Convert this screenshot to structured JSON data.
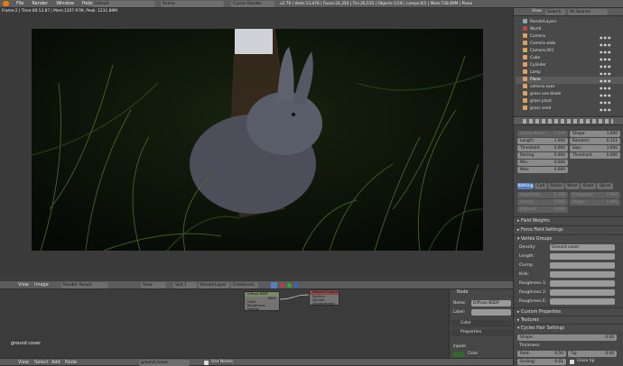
{
  "top": {
    "menus": [
      "File",
      "Render",
      "Window",
      "Help"
    ],
    "layout": "Default",
    "scene": "Scene",
    "engine": "Cycles Render",
    "stats": "v2.79 | Verts:13,476 | Faces:24,350 | Tris:26,535 | Objects:1/18 | Lamps:0/1 | Mem:738.89M | Plane"
  },
  "viewport": {
    "info": "Frame:2 | Time:06:13.87 | Mem:1207.97M, Peak: 1231.89M"
  },
  "image_editor": {
    "menus": [
      "View",
      "Image"
    ],
    "image": "Render Result",
    "view": "View",
    "slot": "Slot 1",
    "layer": "RenderLayer",
    "pass": "Combined"
  },
  "node_editor": {
    "label": "ground cover",
    "menus": [
      "View",
      "Select",
      "Add",
      "Node"
    ],
    "material": "ground cover",
    "use_nodes": "Use Nodes",
    "nodes": [
      {
        "title": "Diffuse BSDF",
        "rows": [
          "BSDF",
          "Color",
          "Roughness",
          "Normal"
        ]
      },
      {
        "title": "Material Output",
        "rows": [
          "Surface",
          "Volume",
          "Displacement"
        ]
      }
    ]
  },
  "node_props": {
    "node_header": "Node",
    "name_label": "Name:",
    "name_value": "Diffuse BSDF",
    "label_label": "Label:",
    "color": "Color",
    "properties": "Properties",
    "inputs": "Inputs:",
    "input_color": "Color"
  },
  "outliner": {
    "menus": [
      "View",
      "Search",
      "All Scenes"
    ],
    "items": [
      "RenderLayers",
      "World",
      "Camera",
      "Camera wide",
      "Camera.001",
      "Cube",
      "Cylinder",
      "Lamp",
      "Plane",
      "camera eyes",
      "grass one blade",
      "grass plant",
      "grass seed"
    ]
  },
  "particles": {
    "clump_noise": {
      "label": "Clump Noise:",
      "value": "1.000"
    },
    "shape": {
      "label": "Shape:",
      "value": "1.000"
    },
    "length": {
      "label": "Length:",
      "value": "1.000"
    },
    "random": {
      "label": "Random:",
      "value": "0.111"
    },
    "threshold": {
      "label": "Threshold:",
      "value": "0.000"
    },
    "size": {
      "label": "Size:",
      "value": "1.000"
    },
    "parting": {
      "label": "Parting:",
      "value": "0.000"
    },
    "threshold2": {
      "label": "Threshold:",
      "value": "0.000"
    },
    "min": {
      "label": "Min:",
      "value": "0.000"
    },
    "max": {
      "label": "Max:",
      "value": "0.000"
    },
    "kink_tabs": [
      "Nothing",
      "Curl",
      "Radial",
      "Wave",
      "Braid",
      "Spiral"
    ],
    "amplitude": {
      "label": "Amplitude:",
      "value": "0.200"
    },
    "frequency": {
      "label": "Frequency:",
      "value": "2.000"
    },
    "clump": {
      "label": "Clump:",
      "value": "0.000"
    },
    "shape2": {
      "label": "Shape:",
      "value": "0.000"
    },
    "flatness": {
      "label": "Flatness:",
      "value": "0.000"
    },
    "panels": [
      "Field Weights",
      "Force Field Settings",
      "Vertex Groups"
    ],
    "density_label": "Density:",
    "density_value": "Ground cover",
    "vg_rows": [
      "Length:",
      "Clump:",
      "Kink:",
      "Roughness 1:",
      "Roughness 2:",
      "Roughness E:"
    ],
    "panels2": [
      "Custom Properties",
      "Textures",
      "Cycles Hair Settings"
    ],
    "hair_shape": {
      "label": "Shape:",
      "value": "0.00"
    },
    "thickness": "Thickness:",
    "root": {
      "label": "Root:",
      "value": "0.50"
    },
    "tip": {
      "label": "Tip:",
      "value": "0.00"
    },
    "scaling": {
      "label": "Scaling:",
      "value": "0.01"
    },
    "close_tip": "Close tip"
  }
}
